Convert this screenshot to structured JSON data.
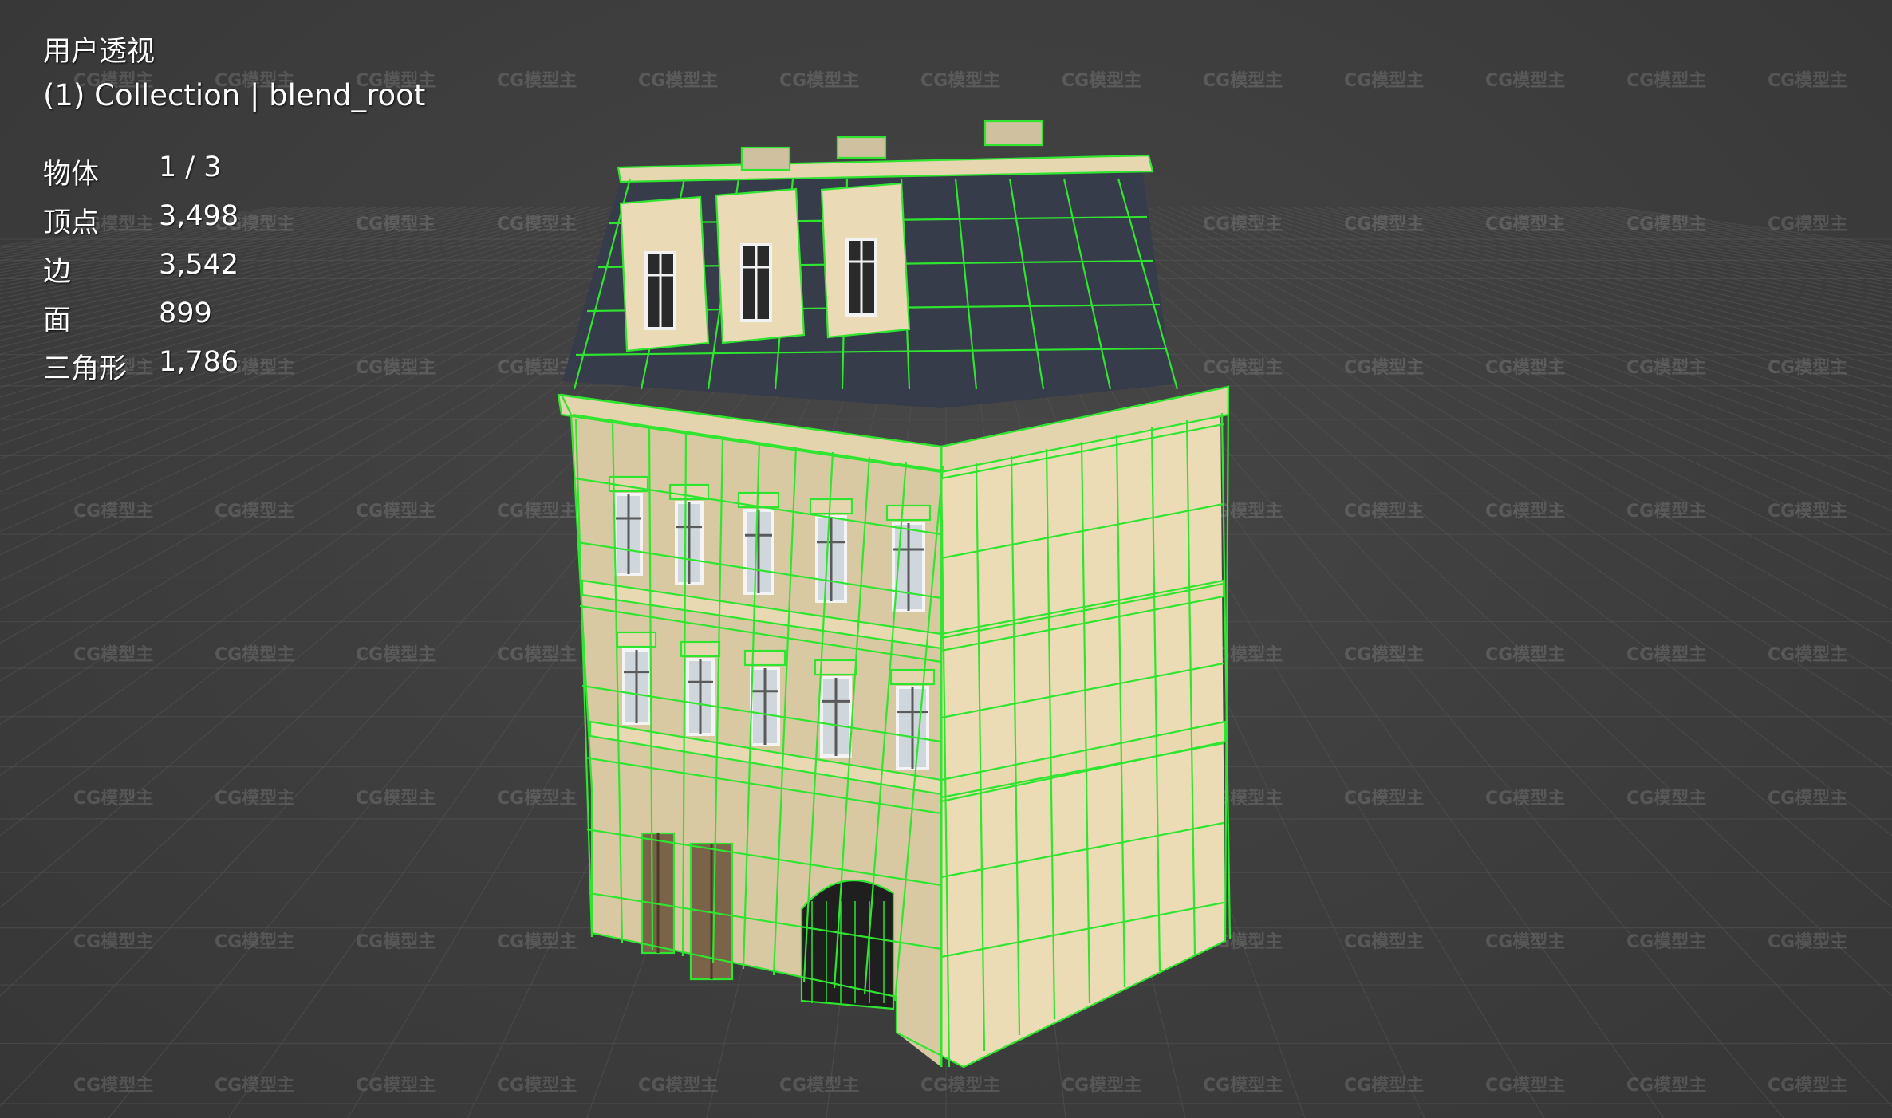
{
  "viewport": {
    "view_name": "用户透视",
    "collection": "(1) Collection | blend_root",
    "stats": [
      {
        "label": "物体",
        "value": "1 / 3"
      },
      {
        "label": "顶点",
        "value": "3,498"
      },
      {
        "label": "边",
        "value": "3,542"
      },
      {
        "label": "面",
        "value": "899"
      },
      {
        "label": "三角形",
        "value": "1,786"
      }
    ]
  },
  "watermark": {
    "text": "CG模型主"
  },
  "colors": {
    "background": "#3d3d3d",
    "wireframe": "#2fe52f",
    "facade": "#ecdcb6",
    "facade_shadow": "#d9c9a2",
    "roof": "#363c4a",
    "window_glass": "#cfd6dc",
    "door_wood": "#7a6348"
  },
  "model": {
    "name": "building",
    "selected": true
  }
}
